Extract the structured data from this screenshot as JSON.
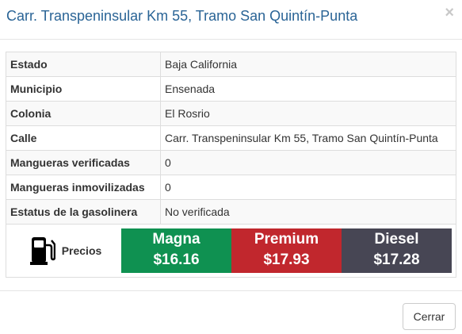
{
  "header": {
    "title": "Carr. Transpeninsular Km 55, Tramo San Quintín-Punta",
    "close_symbol": "×"
  },
  "details": [
    {
      "label": "Estado",
      "value": "Baja California"
    },
    {
      "label": "Municipio",
      "value": "Ensenada"
    },
    {
      "label": "Colonia",
      "value": "El Rosrio"
    },
    {
      "label": "Calle",
      "value": "Carr. Transpeninsular Km 55, Tramo San Quintín-Punta"
    },
    {
      "label": "Mangueras verificadas",
      "value": "0"
    },
    {
      "label": "Mangueras inmovilizadas",
      "value": "0"
    },
    {
      "label": "Estatus de la gasolinera",
      "value": "No verificada"
    }
  ],
  "prices": {
    "label": "Precios",
    "icon": "fuel-pump-icon",
    "fuels": [
      {
        "name": "Magna",
        "price": "$16.16",
        "color": "#0f9151"
      },
      {
        "name": "Premium",
        "price": "$17.93",
        "color": "#c1272d"
      },
      {
        "name": "Diesel",
        "price": "$17.28",
        "color": "#474654"
      }
    ]
  },
  "footer": {
    "close_label": "Cerrar"
  }
}
